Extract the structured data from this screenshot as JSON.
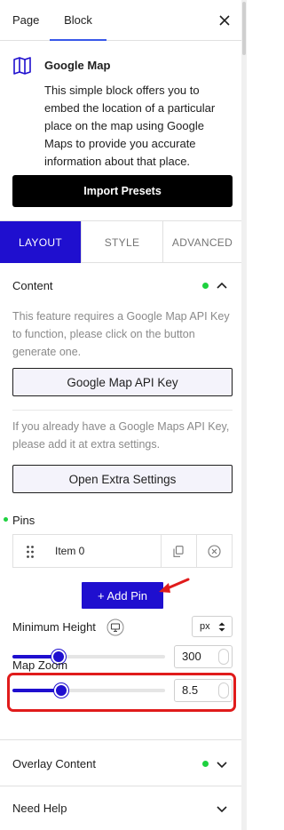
{
  "top_tabs": {
    "page": "Page",
    "block": "Block"
  },
  "block": {
    "title": "Google Map",
    "description": "This simple block offers you to embed the location of a particular place on the map using Google Maps to provide you accurate information about that place.",
    "import_label": "Import Presets"
  },
  "tabs": {
    "layout": "LAYOUT",
    "style": "STYLE",
    "advanced": "ADVANCED"
  },
  "content": {
    "title": "Content",
    "api_hint": "This feature requires a Google Map API Key to function, please click on the button generate one.",
    "api_button": "Google Map API Key",
    "extra_hint": "If you already have a Google Maps API Key, please add it at extra settings.",
    "extra_button": "Open Extra Settings"
  },
  "pins": {
    "title": "Pins",
    "items": [
      {
        "label": "Item 0"
      }
    ],
    "add_label": "+ Add Pin"
  },
  "min_height": {
    "label": "Minimum Height",
    "unit": "px",
    "value": "300",
    "fraction": 0.3
  },
  "map_zoom": {
    "label": "Map Zoom",
    "value": "8.5",
    "fraction": 0.32
  },
  "sections": {
    "overlay": "Overlay Content",
    "help": "Need Help"
  },
  "colors": {
    "accent": "#1f0fcf",
    "active_dot": "#1ed13f",
    "highlight": "#e01b1b"
  }
}
